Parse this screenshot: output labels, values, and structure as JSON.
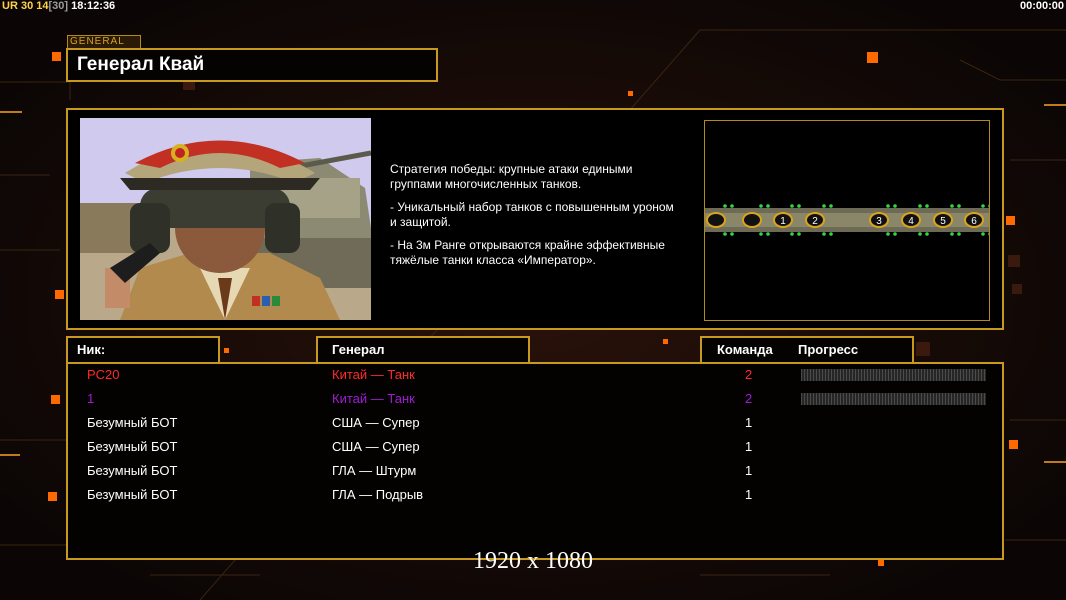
{
  "top_bar": {
    "ur_label": "UR",
    "value_a": "30",
    "value_b": "14",
    "value_c": "[30]",
    "clock": "18:12:36",
    "timer": "00:00:00"
  },
  "general": {
    "tag": "GENERAL",
    "name": "Генерал Квай"
  },
  "description": [
    "Стратегия победы: крупные атаки едиными\n группами многочисленных танков.",
    "- Уникальный набор танков с повышенным уроном\n и защитой.",
    "- На 3м Ранге открываются крайне эффективные\n тяжёлые танки класса «Император»."
  ],
  "map": {
    "slots": [
      "",
      "",
      "1",
      "2",
      "3",
      "4",
      "5",
      "6"
    ]
  },
  "table": {
    "headers": {
      "nick": "Ник:",
      "general": "Генерал",
      "team": "Команда",
      "progress": "Прогресс"
    },
    "rows": [
      {
        "nick": "PC20",
        "general": "Китай — Танк",
        "team": "2",
        "color": "#ff2a2a",
        "progress": 0
      },
      {
        "nick": "1",
        "general": "Китай — Танк",
        "team": "2",
        "color": "#a11cd6",
        "progress": 0
      },
      {
        "nick": "Безумный БОТ",
        "general": "США — Супер",
        "team": "1",
        "color": "#ffffff"
      },
      {
        "nick": "Безумный БОТ",
        "general": "США — Супер",
        "team": "1",
        "color": "#ffffff"
      },
      {
        "nick": "Безумный БОТ",
        "general": "ГЛА — Штурм",
        "team": "1",
        "color": "#ffffff"
      },
      {
        "nick": "Безумный БОТ",
        "general": "ГЛА — Подрыв",
        "team": "1",
        "color": "#ffffff"
      }
    ]
  },
  "resolution_label": "1920 x 1080",
  "colors": {
    "frame_gold": "#c79a1f",
    "accent_orange": "#ff6a00"
  }
}
